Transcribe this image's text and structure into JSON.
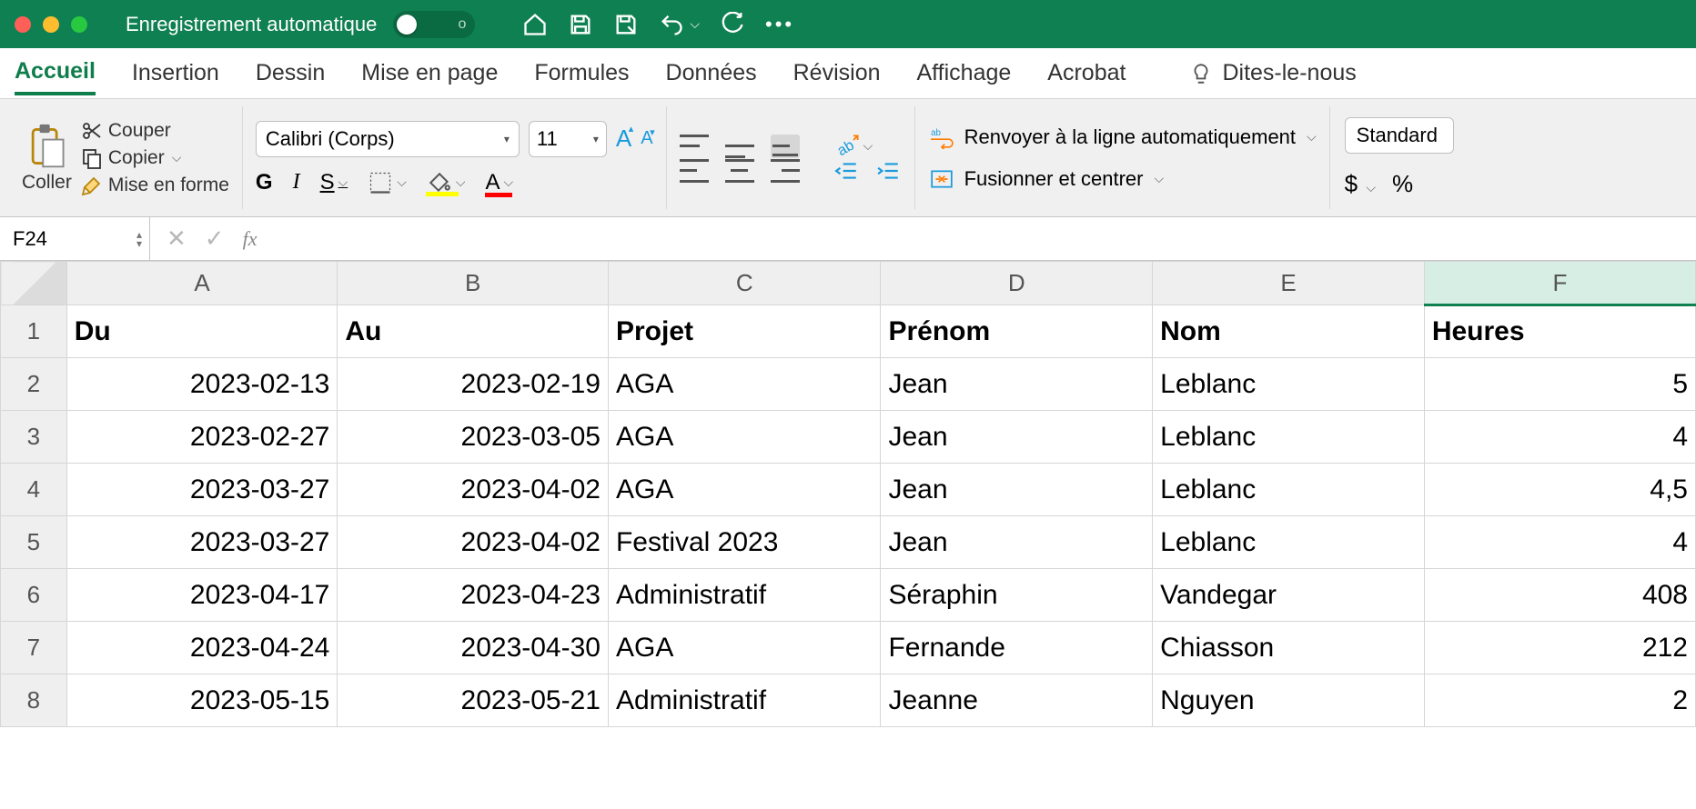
{
  "titleBar": {
    "autosaveLabel": "Enregistrement automatique",
    "autosaveState": "o"
  },
  "ribbonTabs": {
    "home": "Accueil",
    "insert": "Insertion",
    "draw": "Dessin",
    "pageLayout": "Mise en page",
    "formulas": "Formules",
    "data": "Données",
    "review": "Révision",
    "view": "Affichage",
    "acrobat": "Acrobat",
    "tellMe": "Dites-le-nous"
  },
  "ribbon": {
    "clipboard": {
      "paste": "Coller",
      "cut": "Couper",
      "copy": "Copier",
      "formatPainter": "Mise en forme"
    },
    "font": {
      "name": "Calibri (Corps)",
      "size": "11",
      "bold": "G",
      "italic": "I",
      "underline": "S",
      "increaseA": "A",
      "decreaseA": "A",
      "colorA": "A"
    },
    "wrap": {
      "wrapText": "Renvoyer à la ligne automatiquement",
      "merge": "Fusionner et centrer"
    },
    "number": {
      "format": "Standard",
      "currency": "$",
      "percent": "%"
    }
  },
  "nameBox": "F24",
  "fxLabel": "fx",
  "columns": [
    "A",
    "B",
    "C",
    "D",
    "E",
    "F"
  ],
  "rowNumbers": [
    "1",
    "2",
    "3",
    "4",
    "5",
    "6",
    "7",
    "8"
  ],
  "headerRow": {
    "A": "Du",
    "B": "Au",
    "C": "Projet",
    "D": "Prénom",
    "E": "Nom",
    "F": "Heures"
  },
  "rows": [
    {
      "A": "2023-02-13",
      "B": "2023-02-19",
      "C": "AGA",
      "D": "Jean",
      "E": "Leblanc",
      "F": "5"
    },
    {
      "A": "2023-02-27",
      "B": "2023-03-05",
      "C": "AGA",
      "D": "Jean",
      "E": "Leblanc",
      "F": "4"
    },
    {
      "A": "2023-03-27",
      "B": "2023-04-02",
      "C": "AGA",
      "D": "Jean",
      "E": "Leblanc",
      "F": "4,5"
    },
    {
      "A": "2023-03-27",
      "B": "2023-04-02",
      "C": "Festival 2023",
      "D": "Jean",
      "E": "Leblanc",
      "F": "4"
    },
    {
      "A": "2023-04-17",
      "B": "2023-04-23",
      "C": "Administratif",
      "D": "Séraphin",
      "E": "Vandegar",
      "F": "408"
    },
    {
      "A": "2023-04-24",
      "B": "2023-04-30",
      "C": "AGA",
      "D": "Fernande",
      "E": "Chiasson",
      "F": "212"
    },
    {
      "A": "2023-05-15",
      "B": "2023-05-21",
      "C": "Administratif",
      "D": "Jeanne",
      "E": "Nguyen",
      "F": "2"
    }
  ],
  "chart_data": {
    "type": "table",
    "headers": [
      "Du",
      "Au",
      "Projet",
      "Prénom",
      "Nom",
      "Heures"
    ],
    "rows": [
      [
        "2023-02-13",
        "2023-02-19",
        "AGA",
        "Jean",
        "Leblanc",
        5
      ],
      [
        "2023-02-27",
        "2023-03-05",
        "AGA",
        "Jean",
        "Leblanc",
        4
      ],
      [
        "2023-03-27",
        "2023-04-02",
        "AGA",
        "Jean",
        "Leblanc",
        4.5
      ],
      [
        "2023-03-27",
        "2023-04-02",
        "Festival 2023",
        "Jean",
        "Leblanc",
        4
      ],
      [
        "2023-04-17",
        "2023-04-23",
        "Administratif",
        "Séraphin",
        "Vandegar",
        408
      ],
      [
        "2023-04-24",
        "2023-04-30",
        "AGA",
        "Fernande",
        "Chiasson",
        212
      ],
      [
        "2023-05-15",
        "2023-05-21",
        "Administratif",
        "Jeanne",
        "Nguyen",
        2
      ]
    ]
  }
}
